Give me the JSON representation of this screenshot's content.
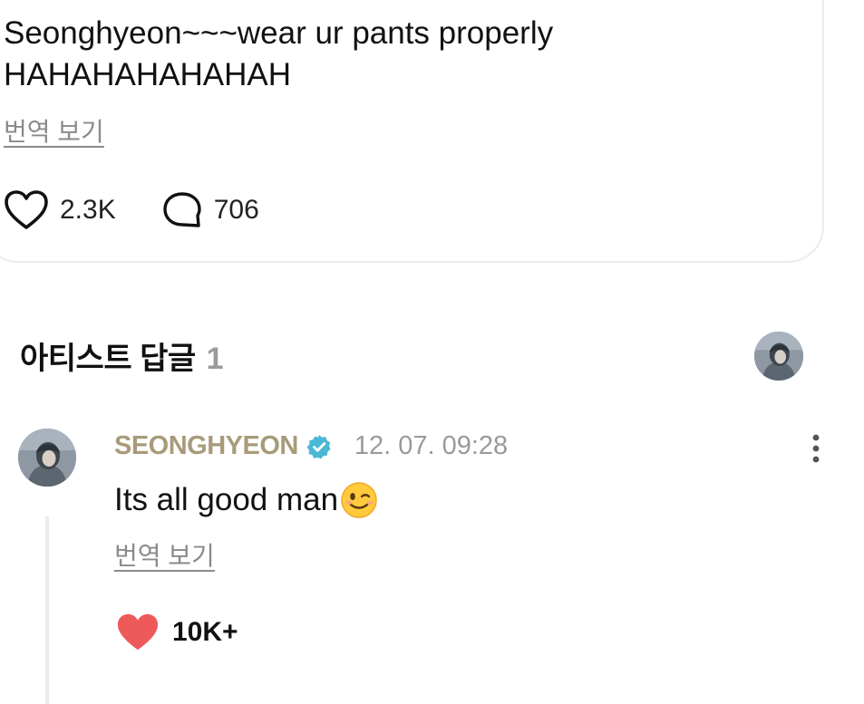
{
  "post": {
    "text": "Seonghyeon~~~wear ur pants properly\nHAHAHAHAHAHAH",
    "translate_label": "번역 보기",
    "like_count": "2.3K",
    "comment_count": "706",
    "icons": {
      "like": "heart-outline-icon",
      "comment": "speech-bubble-icon"
    }
  },
  "artist_replies": {
    "title": "아티스트 답글",
    "count": "1",
    "header_avatar": "artist-avatar"
  },
  "reply": {
    "author": "SEONGHYEON",
    "verified": true,
    "timestamp": "12. 07. 09:28",
    "text": "Its all good man",
    "emoji": "winking-face-emoji",
    "translate_label": "번역 보기",
    "like_count": "10K+",
    "liked": true,
    "icons": {
      "more": "more-vertical-icon",
      "like": "heart-filled-icon",
      "verified": "verified-badge-icon"
    }
  },
  "colors": {
    "author_name": "#a89b7a",
    "verified_badge": "#4bb8d4",
    "liked_heart": "#ee5a5a",
    "muted_text": "#8a8a8a",
    "card_border": "#ececec"
  }
}
